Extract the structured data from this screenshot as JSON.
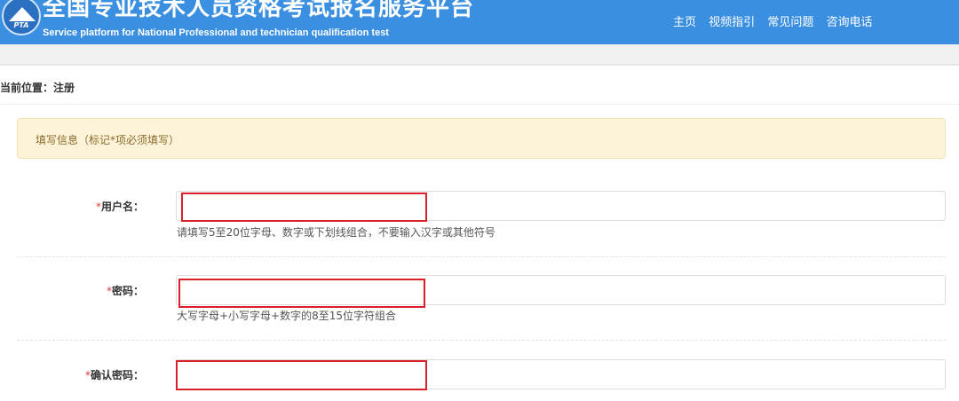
{
  "header": {
    "logo_text": "PTA",
    "title": "全国专业技术人员资格考试报名服务平台",
    "subtitle": "Service platform for National Professional and technician qualification test",
    "nav": [
      "主页",
      "视频指引",
      "常见问题",
      "咨询电话"
    ],
    "colors": {
      "bar": "#3b8fe0"
    }
  },
  "breadcrumb": {
    "text": "当前位置：注册"
  },
  "notice": {
    "text": "填写信息（标记*项必须填写）"
  },
  "form": {
    "required_mark": "*",
    "fields": [
      {
        "label": "用户名：",
        "value": "",
        "hint": "请填写5至20位字母、数字或下划线组合，不要输入汉字或其他符号"
      },
      {
        "label": "密码：",
        "value": "",
        "hint": "大写字母+小写字母+数字的8至15位字符组合"
      },
      {
        "label": "确认密码：",
        "value": "",
        "hint": ""
      }
    ]
  }
}
